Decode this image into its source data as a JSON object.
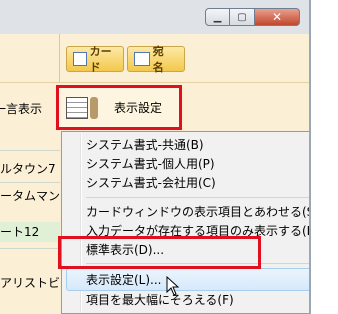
{
  "toolbar": {
    "card_label": "カード",
    "address_label": "宛 名"
  },
  "row2": {
    "left_text": "一言表示",
    "display_settings_label": "表示設定"
  },
  "grid": {
    "cells": [
      "ルタウン7",
      "ータムマンシ",
      "ート12",
      "アリストビル"
    ]
  },
  "menu": {
    "items": [
      {
        "label": "システム書式-共通(B)",
        "submenu": true
      },
      {
        "label": "システム書式-個人用(P)",
        "submenu": true
      },
      {
        "label": "システム書式-会社用(C)",
        "submenu": true
      },
      {
        "label": "カードウィンドウの表示項目とあわせる(S)"
      },
      {
        "label": "入力データが存在する項目のみ表示する(E)"
      },
      {
        "label": "標準表示(D)..."
      },
      {
        "label": "表示設定(L)..."
      },
      {
        "label": "項目を最大幅にそろえる(F)"
      }
    ]
  },
  "window": {
    "min_icon": "minimize-icon",
    "max_icon": "maximize-icon",
    "close_icon": "close-icon"
  },
  "colors": {
    "highlight_outline": "#e0101e",
    "panel_bg": "#fbf0d6",
    "menu_hover": "#d6e9fb"
  }
}
